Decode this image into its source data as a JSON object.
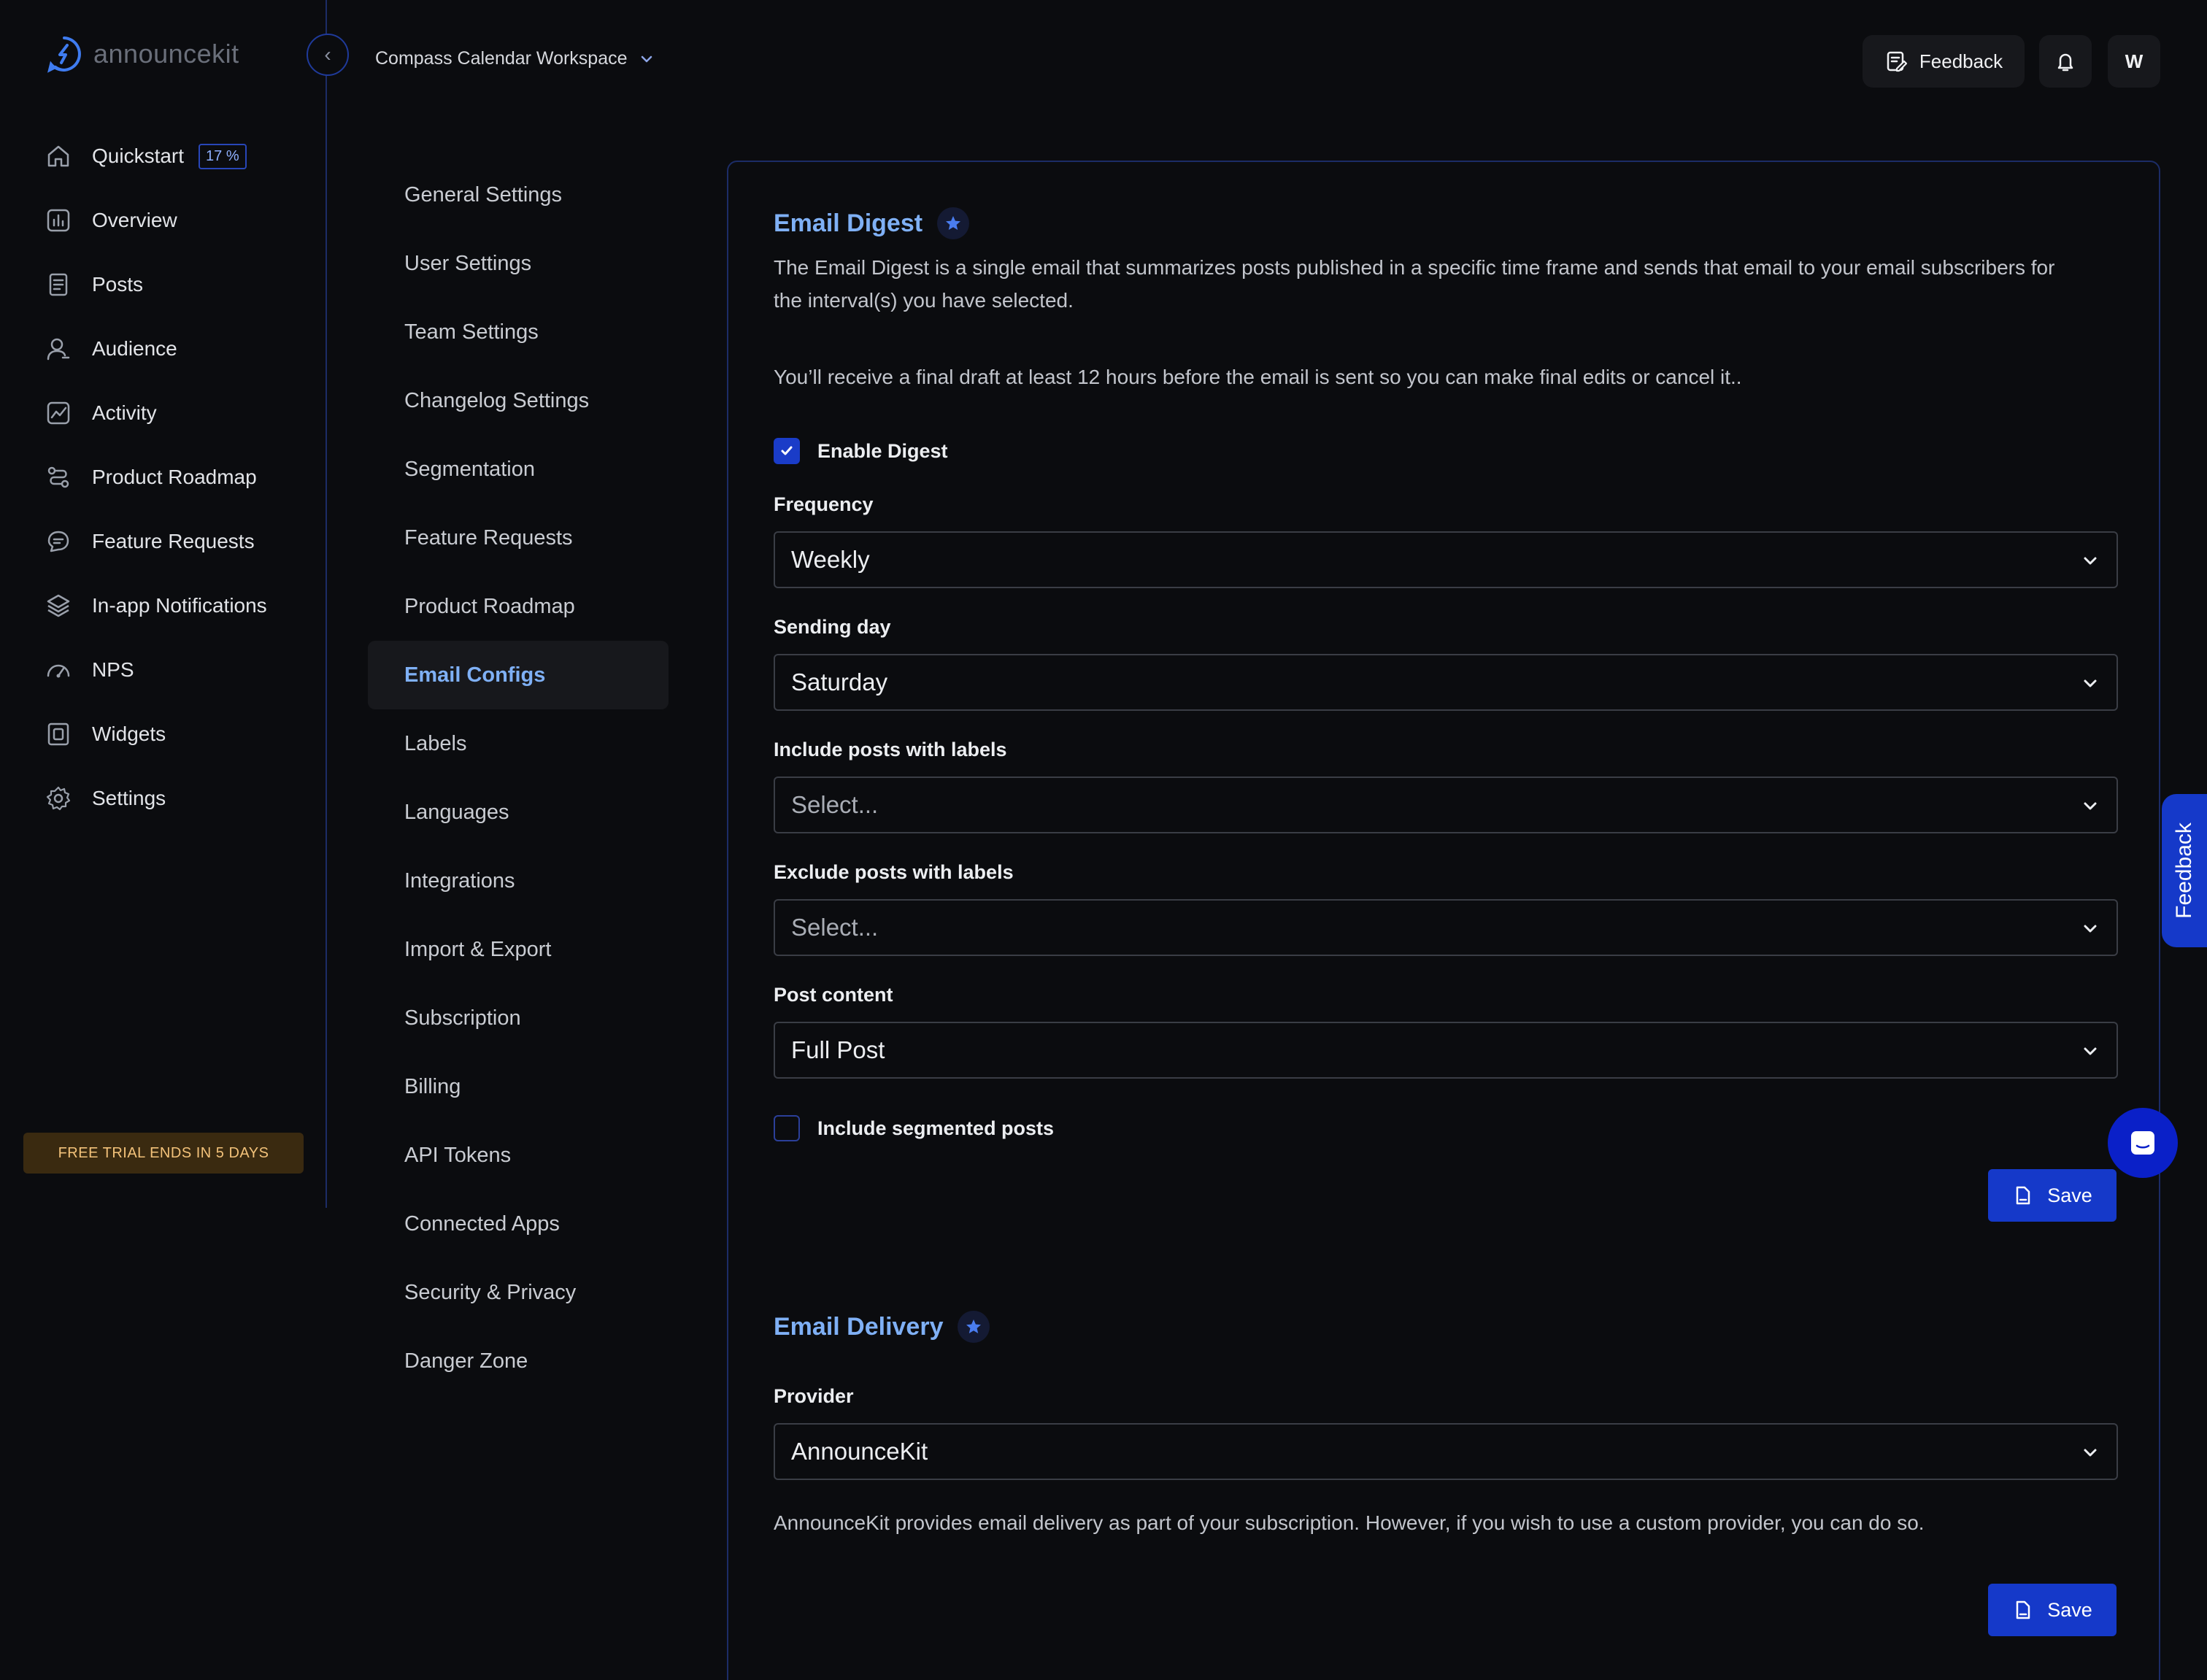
{
  "brand": {
    "name": "announcekit"
  },
  "header": {
    "workspace": "Compass Calendar Workspace",
    "feedback_label": "Feedback",
    "avatar_initial": "W"
  },
  "sidebar": {
    "quickstart_badge": "17 %",
    "items": [
      {
        "label": "Quickstart",
        "icon": "home-icon"
      },
      {
        "label": "Overview",
        "icon": "bar-chart-icon"
      },
      {
        "label": "Posts",
        "icon": "document-icon"
      },
      {
        "label": "Audience",
        "icon": "user-icon"
      },
      {
        "label": "Activity",
        "icon": "activity-chart-icon"
      },
      {
        "label": "Product Roadmap",
        "icon": "roadmap-icon"
      },
      {
        "label": "Feature Requests",
        "icon": "chat-icon"
      },
      {
        "label": "In-app Notifications",
        "icon": "layers-icon"
      },
      {
        "label": "NPS",
        "icon": "gauge-icon"
      },
      {
        "label": "Widgets",
        "icon": "widget-icon"
      },
      {
        "label": "Settings",
        "icon": "gear-icon"
      }
    ],
    "trial_banner": "FREE TRIAL ENDS IN 5 DAYS"
  },
  "settings_menu": {
    "active": "Email Configs",
    "items": [
      "General Settings",
      "User Settings",
      "Team Settings",
      "Changelog Settings",
      "Segmentation",
      "Feature Requests",
      "Product Roadmap",
      "Email Configs",
      "Labels",
      "Languages",
      "Integrations",
      "Import & Export",
      "Subscription",
      "Billing",
      "API Tokens",
      "Connected Apps",
      "Security & Privacy",
      "Danger Zone"
    ]
  },
  "email_digest": {
    "title": "Email Digest",
    "description": "The Email Digest is a single email that summarizes posts published in a specific time frame and sends that email to your email subscribers for the interval(s) you have selected.",
    "note": "You’ll receive a final draft at least 12 hours before the email is sent so you can make final edits or cancel it..",
    "enable_label": "Enable Digest",
    "enable_checked": true,
    "frequency_label": "Frequency",
    "frequency_value": "Weekly",
    "sending_day_label": "Sending day",
    "sending_day_value": "Saturday",
    "include_labels_label": "Include posts with labels",
    "include_labels_placeholder": "Select...",
    "exclude_labels_label": "Exclude posts with labels",
    "exclude_labels_placeholder": "Select...",
    "post_content_label": "Post content",
    "post_content_value": "Full Post",
    "segmented_label": "Include segmented posts",
    "segmented_checked": false,
    "save_label": "Save"
  },
  "email_delivery": {
    "title": "Email Delivery",
    "provider_label": "Provider",
    "provider_value": "AnnounceKit",
    "description": "AnnounceKit provides email delivery as part of your subscription. However, if you wish to use a custom provider, you can do so.",
    "save_label": "Save"
  },
  "floating": {
    "side_feedback_label": "Feedback"
  },
  "colors": {
    "accent": "#7fb0f5",
    "primary_button": "#1539c9",
    "border": "#1c2c66",
    "background": "#0b0c0f",
    "trial_bg": "#3a2a10",
    "trial_text": "#f3c27a"
  }
}
